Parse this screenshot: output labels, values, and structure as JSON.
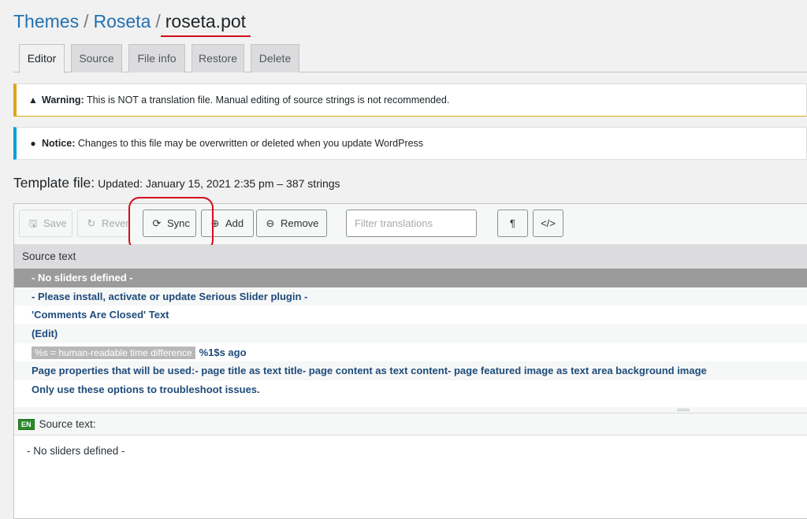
{
  "breadcrumb": {
    "item1": "Themes",
    "item2": "Roseta",
    "separator": "/",
    "current": "roseta.pot"
  },
  "tabs": [
    {
      "label": "Editor",
      "active": true
    },
    {
      "label": "Source",
      "active": false
    },
    {
      "label": "File info",
      "active": false
    },
    {
      "label": "Restore",
      "active": false
    },
    {
      "label": "Delete",
      "active": false
    }
  ],
  "warning": {
    "icon": "warning-icon",
    "title": "Warning:",
    "message": "This is NOT a translation file. Manual editing of source strings is not recommended."
  },
  "notice": {
    "icon": "info-icon",
    "title": "Notice:",
    "message": "Changes to this file may be overwritten or deleted when you update WordPress"
  },
  "template": {
    "label": "Template file:",
    "value": "Updated: January 15, 2021 2:35 pm – 387 strings"
  },
  "toolbar": {
    "save_label": "Save",
    "revert_label": "Revert",
    "sync_label": "Sync",
    "add_label": "Add",
    "remove_label": "Remove",
    "filter_placeholder": "Filter translations",
    "pilcrow_glyph": "¶",
    "code_glyph": "</>"
  },
  "list": {
    "header": "Source text",
    "rows": [
      {
        "text": "- No sliders defined -",
        "selected": true
      },
      {
        "text": "- Please install, activate or update Serious Slider plugin -"
      },
      {
        "text": "'Comments Are Closed' Text"
      },
      {
        "text": "(Edit)"
      },
      {
        "tag": "%s = human-readable time difference",
        "text": "%1$s ago"
      },
      {
        "text": "Page properties that will be used:- page title as text title- page content as text content- page featured image as text area background image"
      },
      {
        "text": "Only use these options to troubleshoot issues."
      }
    ]
  },
  "source_panel": {
    "lang_badge": "EN",
    "label": "Source text:",
    "value": "- No sliders defined -"
  },
  "colors": {
    "accent": "#2271b1",
    "highlight": "#d40b1c",
    "warning": "#dba617",
    "info": "#00a0d2",
    "string_text": "#1e4b7a"
  }
}
